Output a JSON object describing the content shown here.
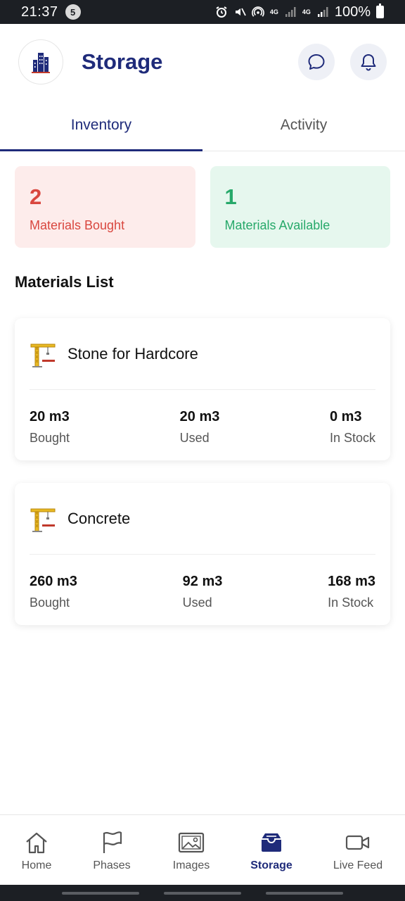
{
  "status_bar": {
    "time": "21:37",
    "notification_count": "5",
    "net1": "4G",
    "net2": "4G",
    "battery": "100%"
  },
  "header": {
    "title": "Storage"
  },
  "tabs": [
    {
      "label": "Inventory",
      "active": true
    },
    {
      "label": "Activity",
      "active": false
    }
  ],
  "summary": {
    "bought": {
      "value": "2",
      "label": "Materials Bought",
      "color": "#d9473f"
    },
    "available": {
      "value": "1",
      "label": "Materials Available",
      "color": "#27a96a"
    }
  },
  "materials_list": {
    "title": "Materials List",
    "items": [
      {
        "name": "Stone for Hardcore",
        "icon": "crane-icon",
        "bought": {
          "value": "20 m3",
          "label": "Bought"
        },
        "used": {
          "value": "20 m3",
          "label": "Used"
        },
        "in_stock": {
          "value": "0 m3",
          "label": "In Stock"
        }
      },
      {
        "name": "Concrete",
        "icon": "crane-icon",
        "bought": {
          "value": "260 m3",
          "label": "Bought"
        },
        "used": {
          "value": "92 m3",
          "label": "Used"
        },
        "in_stock": {
          "value": "168 m3",
          "label": "In Stock"
        }
      }
    ]
  },
  "bottom_nav": [
    {
      "label": "Home",
      "icon": "home-icon"
    },
    {
      "label": "Phases",
      "icon": "flag-icon"
    },
    {
      "label": "Images",
      "icon": "image-icon"
    },
    {
      "label": "Storage",
      "icon": "storage-icon",
      "active": true
    },
    {
      "label": "Live Feed",
      "icon": "video-icon"
    }
  ],
  "colors": {
    "accent": "#1f2b7a",
    "bought_bg": "#fdeceb",
    "available_bg": "#e6f7ee"
  }
}
